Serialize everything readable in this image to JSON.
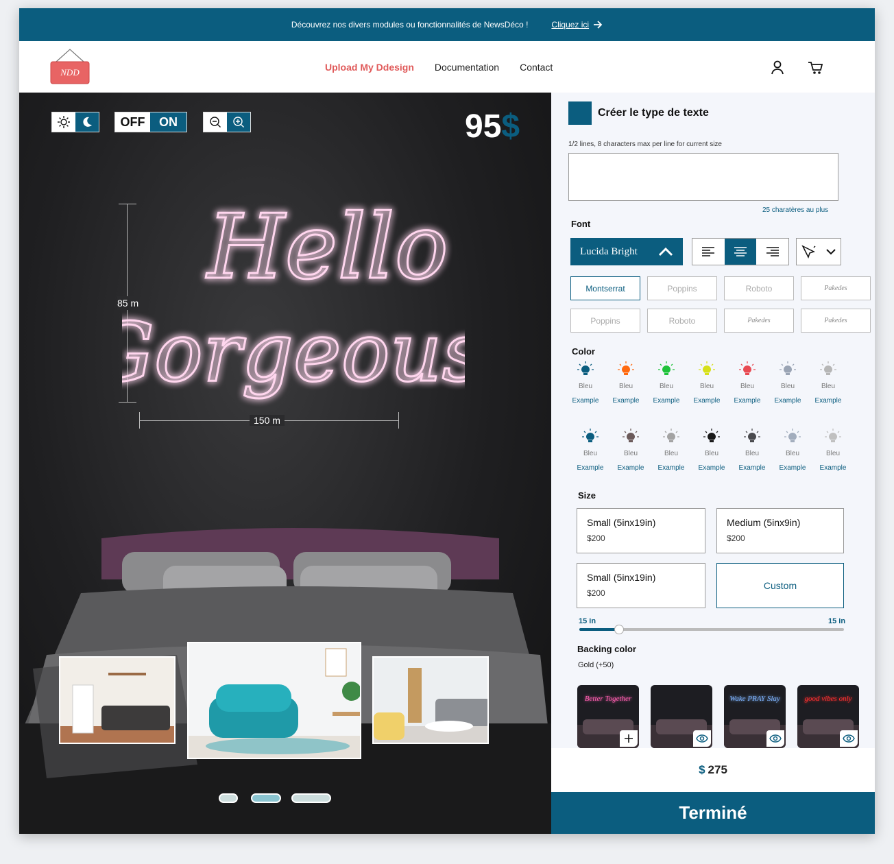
{
  "banner": {
    "message": "Découvrez nos divers modules ou fonctionnalités de NewsDéco !",
    "link_label": "Cliquez ici"
  },
  "logo": {
    "text": "NDD"
  },
  "nav": [
    {
      "label": "Upload My Ddesign",
      "active": true
    },
    {
      "label": "Documentation",
      "active": false
    },
    {
      "label": "Contact",
      "active": false
    }
  ],
  "preview": {
    "power": {
      "off_label": "OFF",
      "on_label": "ON",
      "state": "ON"
    },
    "price": {
      "amount": "95",
      "currency": "$"
    },
    "neon_text": {
      "line1": "Hello",
      "line2": "Gorgeous",
      "color": "#ff8fd0"
    },
    "height_label": "85 m",
    "width_label": "150 m",
    "rooms_selected_index": 1
  },
  "panel": {
    "title": "Créer le type de texte",
    "text_hint": "1/2 lines, 8 characters max per line for current size",
    "text_value": "",
    "char_limit": "25 charatères au plus",
    "font_label": "Font",
    "font_selected": "Lucida Bright",
    "text_align": "center",
    "font_options": [
      "Montserrat",
      "Poppins",
      "Roboto",
      "Pakedes",
      "Poppins",
      "Roboto",
      "Pakedes",
      "Pakedes"
    ],
    "font_selected_index": 0,
    "color_label": "Color",
    "colors_row1": [
      {
        "name": "Bleu",
        "example": "Example",
        "hex": "#0b5d7f"
      },
      {
        "name": "Bleu",
        "example": "Example",
        "hex": "#ff6a10"
      },
      {
        "name": "Bleu",
        "example": "Example",
        "hex": "#1fc23a"
      },
      {
        "name": "Bleu",
        "example": "Example",
        "hex": "#d7e01a"
      },
      {
        "name": "Bleu",
        "example": "Example",
        "hex": "#e84a52"
      },
      {
        "name": "Bleu",
        "example": "Example",
        "hex": "#9aa4b4"
      },
      {
        "name": "Bleu",
        "example": "Example",
        "hex": "#b6b6b6"
      }
    ],
    "colors_row2": [
      {
        "name": "Bleu",
        "example": "Example",
        "hex": "#0b5d7f"
      },
      {
        "name": "Bleu",
        "example": "Example",
        "hex": "#6b5a5a"
      },
      {
        "name": "Bleu",
        "example": "Example",
        "hex": "#a3a3a3"
      },
      {
        "name": "Bleu",
        "example": "Example",
        "hex": "#1a1a1a"
      },
      {
        "name": "Bleu",
        "example": "Example",
        "hex": "#4a4a4e"
      },
      {
        "name": "Bleu",
        "example": "Example",
        "hex": "#a2adbd"
      },
      {
        "name": "Bleu",
        "example": "Example",
        "hex": "#c0c0c0"
      }
    ],
    "size_label": "Size",
    "sizes": [
      {
        "title": "Small (5inx19in)",
        "price": "$200"
      },
      {
        "title": "Medium (5inx9in)",
        "price": "$200"
      },
      {
        "title": "Small (5inx19in)",
        "price": "$200"
      }
    ],
    "custom_label": "Custom",
    "range_min_label": "15 in",
    "range_max_label": "15 in",
    "slider_fraction": 0.15,
    "backing_label": "Backing color",
    "backing_value": "Gold (+50)",
    "backings": [
      {
        "text": "Better Together",
        "color": "#ff5fb0",
        "action": "add"
      },
      {
        "text": "",
        "color": "#ff3a3a",
        "action": "view"
      },
      {
        "text": "Wake PRAY Slay",
        "color": "#7fb4ff",
        "action": "view"
      },
      {
        "text": "good vibes only",
        "color": "#ff3030",
        "action": "view"
      }
    ],
    "total": {
      "currency": "$",
      "amount": "275"
    },
    "done_label": "Terminé"
  },
  "colors": {
    "accent": "#0b5d7f",
    "brand": "#e05a5a"
  }
}
